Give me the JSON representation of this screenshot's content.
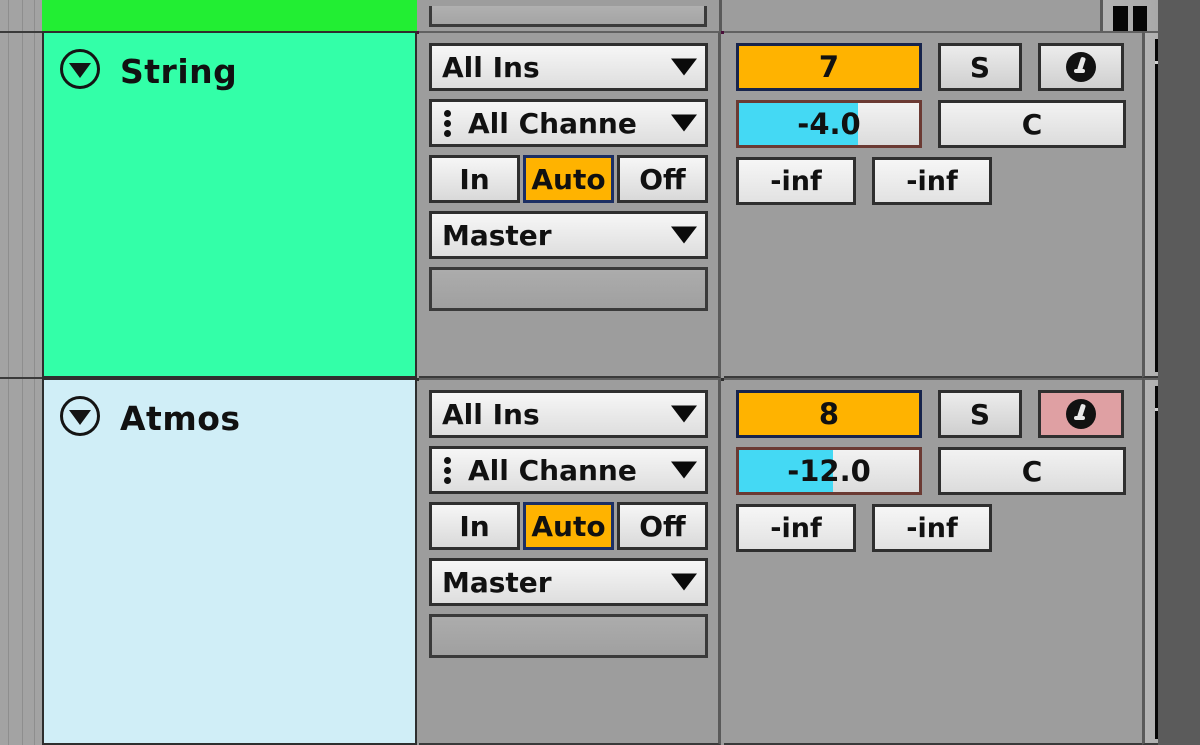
{
  "app": {
    "name": "daw-track-mixer"
  },
  "colors": {
    "panel_bg": "#9d9d9d",
    "accent_orange": "#ffb300",
    "accent_cyan": "#44d9f4",
    "armed_red": "#dfa0a3",
    "track_string": "#33ffa8",
    "track_atmos": "#d0eef7",
    "track_partial_green": "#22ee33",
    "selected_border": "#4a0f3a"
  },
  "partial_track": {
    "color": "#22ee33",
    "name": ""
  },
  "tracks": [
    {
      "id": "string",
      "name": "String",
      "color": "#33ffa8",
      "selected": true,
      "fold_icon": "chevron-down-circle-icon",
      "io": {
        "input_type": "All Ins",
        "input_channel": "All Channe",
        "monitor_options": [
          "In",
          "Auto",
          "Off"
        ],
        "monitor_selected": "Auto",
        "output_type": "Master",
        "output_channel": ""
      },
      "mixer": {
        "send_value": "7",
        "solo_label": "S",
        "arm_icon": "record-arm-icon",
        "armed": false,
        "volume": "-4.0",
        "volume_fill_pct": 66,
        "pan": "C",
        "meter_left": "-inf",
        "meter_right": "-inf"
      }
    },
    {
      "id": "atmos",
      "name": "Atmos",
      "color": "#d0eef7",
      "selected": false,
      "fold_icon": "chevron-down-circle-icon",
      "io": {
        "input_type": "All Ins",
        "input_channel": "All Channe",
        "monitor_options": [
          "In",
          "Auto",
          "Off"
        ],
        "monitor_selected": "Auto",
        "output_type": "Master",
        "output_channel": ""
      },
      "mixer": {
        "send_value": "8",
        "solo_label": "S",
        "arm_icon": "record-arm-icon",
        "armed": true,
        "volume": "-12.0",
        "volume_fill_pct": 52,
        "pan": "C",
        "meter_left": "-inf",
        "meter_right": "-inf"
      }
    }
  ]
}
